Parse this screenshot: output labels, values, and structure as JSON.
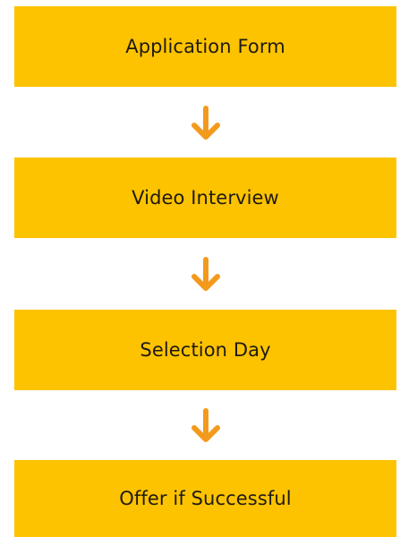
{
  "colors": {
    "box_fill": "#FDC300",
    "arrow": "#F39A1C",
    "text": "#1F1A12",
    "background": "#FFFFFF"
  },
  "steps": [
    {
      "label": "Application Form"
    },
    {
      "label": "Video Interview"
    },
    {
      "label": "Selection Day"
    },
    {
      "label": "Offer if Successful"
    }
  ],
  "arrows": [
    {
      "icon": "arrow-down-icon"
    },
    {
      "icon": "arrow-down-icon"
    },
    {
      "icon": "arrow-down-icon"
    }
  ]
}
